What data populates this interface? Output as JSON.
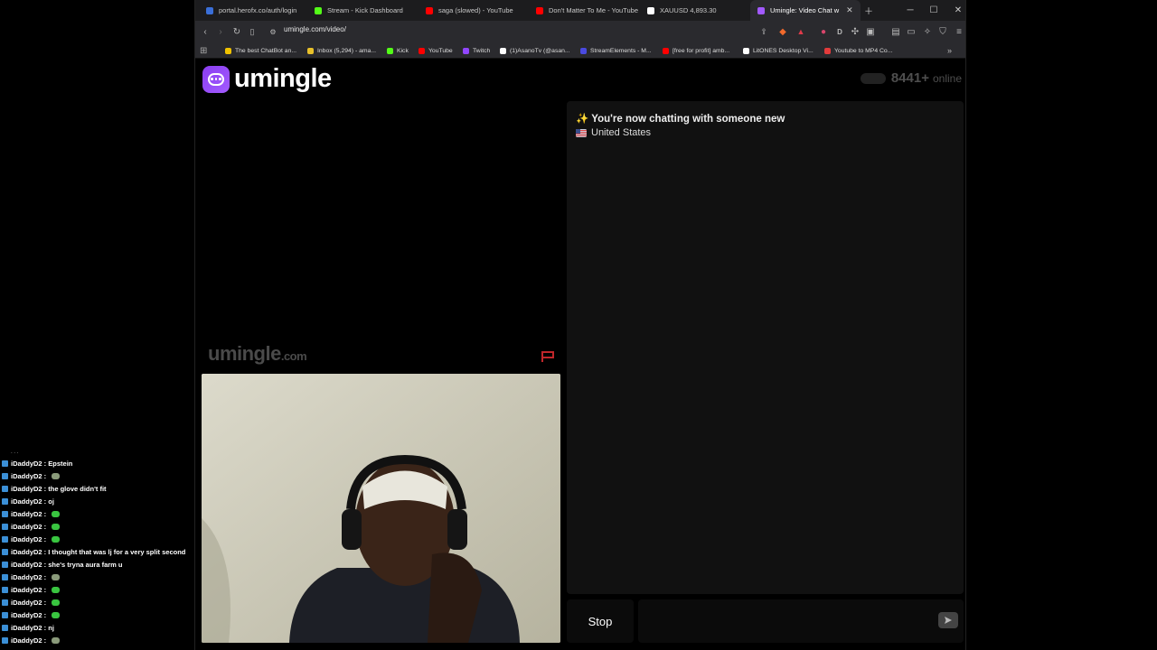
{
  "tabs": [
    {
      "label": "portal.herofx.co/auth/login",
      "color": "#3a6fd8"
    },
    {
      "label": "Stream - Kick Dashboard",
      "color": "#53fc18"
    },
    {
      "label": "saga (slowed) - YouTube",
      "color": "#ff0000"
    },
    {
      "label": "Don't Matter To Me - YouTube",
      "color": "#ff0000"
    },
    {
      "label": "XAUUSD 4,893.30",
      "color": "#ffffff"
    },
    {
      "label": "Umingle: Video Chat w",
      "color": "#a259ff"
    }
  ],
  "address_bar": {
    "url": "umingle.com/video/"
  },
  "bookmarks": [
    {
      "label": "The best ChatBot an...",
      "color": "#f0c200"
    },
    {
      "label": "Inbox (5,294) - ama...",
      "color": "#e8c02a"
    },
    {
      "label": "Kick",
      "color": "#53fc18"
    },
    {
      "label": "YouTube",
      "color": "#ff0000"
    },
    {
      "label": "Twitch",
      "color": "#9146ff"
    },
    {
      "label": "(1)AsanoTv (@asan...",
      "color": "#ffffff"
    },
    {
      "label": "StreamElements - M...",
      "color": "#4a4ae0"
    },
    {
      "label": "[free for profit] amb...",
      "color": "#ff0000"
    },
    {
      "label": "LitONES Desktop Vi...",
      "color": "#ffffff"
    },
    {
      "label": "Youtube to MP4 Co...",
      "color": "#e23b3b"
    }
  ],
  "site": {
    "logo_text": "umingle",
    "online_count": "8441+",
    "online_label": "online",
    "watermark": "umingle",
    "watermark_suffix": ".com"
  },
  "chat_panel": {
    "system_message": "✨ You're now chatting with someone new",
    "country": "United States"
  },
  "controls": {
    "stop_label": "Stop"
  },
  "stream_chat": [
    {
      "user": "iDaddyD2",
      "text": "Epstein",
      "emote": ""
    },
    {
      "user": "iDaddyD2",
      "text": "",
      "emote": "gray"
    },
    {
      "user": "iDaddyD2",
      "text": "the glove didn't fit",
      "emote": ""
    },
    {
      "user": "iDaddyD2",
      "text": "oj",
      "emote": ""
    },
    {
      "user": "iDaddyD2",
      "text": "",
      "emote": "green"
    },
    {
      "user": "iDaddyD2",
      "text": "",
      "emote": "green"
    },
    {
      "user": "iDaddyD2",
      "text": "",
      "emote": "green"
    },
    {
      "user": "iDaddyD2",
      "text": "I thought that was lj for a very split second",
      "emote": ""
    },
    {
      "user": "iDaddyD2",
      "text": "she's tryna aura farm u",
      "emote": ""
    },
    {
      "user": "iDaddyD2",
      "text": "",
      "emote": "gray"
    },
    {
      "user": "iDaddyD2",
      "text": "",
      "emote": "green"
    },
    {
      "user": "iDaddyD2",
      "text": "",
      "emote": "green"
    },
    {
      "user": "iDaddyD2",
      "text": "",
      "emote": "green"
    },
    {
      "user": "iDaddyD2",
      "text": "nj",
      "emote": ""
    },
    {
      "user": "iDaddyD2",
      "text": "",
      "emote": "gray"
    }
  ]
}
